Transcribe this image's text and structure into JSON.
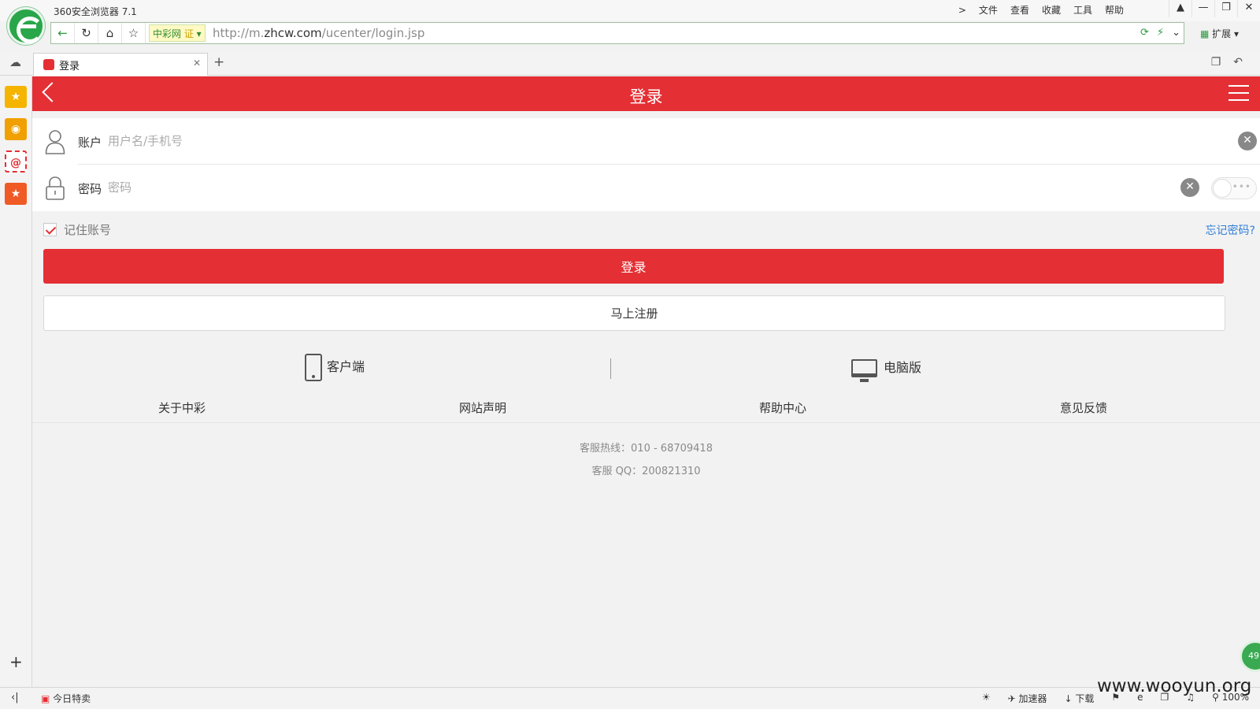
{
  "browser": {
    "title": "360安全浏览器 7.1",
    "menu": [
      "文件",
      "查看",
      "收藏",
      "工具",
      "帮助"
    ],
    "menu_chevron": ">",
    "url_prefix": "http://m.",
    "url_domain": "zhcw.com",
    "url_path": "/ucenter/login.jsp",
    "cert_label": "中彩网",
    "cert_badge": "证",
    "extension_label": "扩展",
    "tab_title": "登录",
    "status_deal": "今日特卖",
    "status_accelerator": "加速器",
    "status_download": "下载",
    "zoom": "100%",
    "float_badge": "49",
    "watermark": "www.wooyun.org"
  },
  "header": {
    "title": "登录"
  },
  "form": {
    "account_label": "账户",
    "account_placeholder": "用户名/手机号",
    "password_label": "密码",
    "password_placeholder": "密码",
    "remember_label": "记住账号",
    "remember_checked": true,
    "forgot_link": "忘记密码?",
    "login_button": "登录",
    "register_button": "马上注册"
  },
  "clients": {
    "mobile": "客户端",
    "desktop": "电脑版"
  },
  "footer": {
    "links": [
      "关于中彩",
      "网站声明",
      "帮助中心",
      "意见反馈"
    ],
    "hotline": "客服热线：010 - 68709418",
    "qq": "客服 QQ：200821310"
  },
  "colors": {
    "brand_red": "#e42f34",
    "link_blue": "#2f7fd6"
  }
}
